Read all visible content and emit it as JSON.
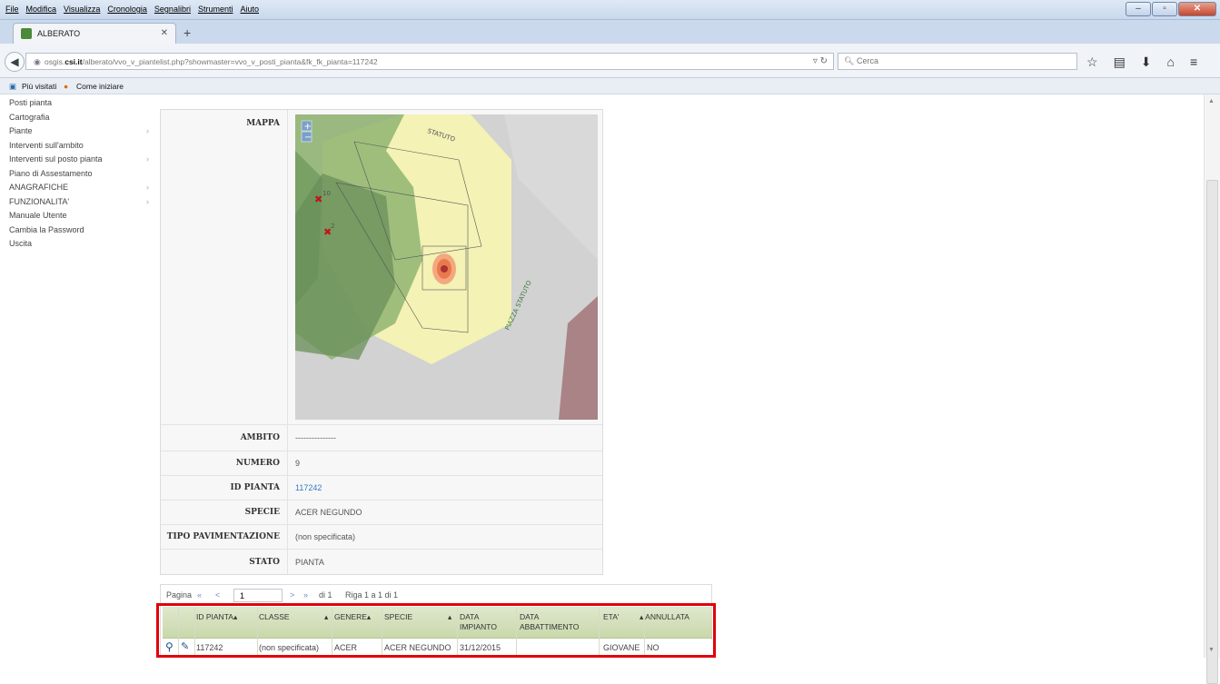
{
  "browser": {
    "menu": [
      "File",
      "Modifica",
      "Visualizza",
      "Cronologia",
      "Segnalibri",
      "Strumenti",
      "Aiuto"
    ],
    "tab_title": "ALBERATO",
    "url_prefix": "osgis.",
    "url_host": "csi.it",
    "url_path": "/alberato/vvo_v_piantelist.php?showmaster=vvo_v_posti_pianta&fk_fk_pianta=117242",
    "search_placeholder": "Cerca",
    "bookmarks": [
      "Più visitati",
      "Come iniziare"
    ]
  },
  "sidebar": {
    "items": [
      {
        "label": "Posti pianta",
        "submenu": false
      },
      {
        "label": "Cartografia",
        "submenu": false
      },
      {
        "label": "Piante",
        "submenu": true
      },
      {
        "label": "Interventi sull'ambito",
        "submenu": false
      },
      {
        "label": "Interventi sul posto pianta",
        "submenu": true
      },
      {
        "label": "Piano di Assestamento",
        "submenu": false
      },
      {
        "label": "ANAGRAFICHE",
        "submenu": true
      },
      {
        "label": "FUNZIONALITA'",
        "submenu": true
      },
      {
        "label": "Manuale Utente",
        "submenu": false
      },
      {
        "label": "Cambia la Password",
        "submenu": false
      },
      {
        "label": "Uscita",
        "submenu": false
      }
    ]
  },
  "detail": {
    "map_label": "MAPPA",
    "map": {
      "street_top": "STATUTO",
      "street_diag": "PIAZZA STATUTO",
      "marker_labels": [
        "10",
        "2"
      ]
    },
    "rows": [
      {
        "label": "AMBITO",
        "value": "---------------"
      },
      {
        "label": "NUMERO",
        "value": "9"
      },
      {
        "label": "ID PIANTA",
        "value": "117242"
      },
      {
        "label": "SPECIE",
        "value": "ACER NEGUNDO"
      },
      {
        "label": "TIPO PAVIMENTAZIONE",
        "value": "(non specificata)"
      },
      {
        "label": "STATO",
        "value": "PIANTA"
      }
    ]
  },
  "pager": {
    "label": "Pagina",
    "first": "«",
    "prev": "<",
    "current": "1",
    "next": ">",
    "last": "»",
    "of": "di 1",
    "rows": "Riga 1 a 1 di 1"
  },
  "grid": {
    "headers": [
      "ID PIANTA",
      "CLASSE",
      "GENERE",
      "SPECIE",
      "DATA IMPIANTO",
      "DATA ABBATTIMENTO",
      "ETA'",
      "ANNULLATA"
    ],
    "row": [
      "117242",
      "(non specificata)",
      "ACER",
      "ACER NEGUNDO",
      "31/12/2015",
      "",
      "GIOVANE",
      "NO"
    ]
  }
}
